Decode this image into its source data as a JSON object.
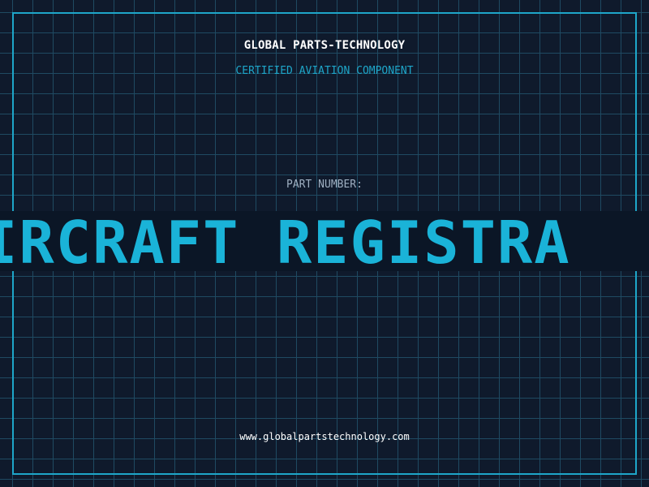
{
  "header": {
    "company_name": "GLOBAL PARTS-TECHNOLOGY",
    "subtitle": "CERTIFIED AVIATION COMPONENT"
  },
  "part": {
    "label": "PART NUMBER:",
    "value_visible": "Y AIRCRAFT REGISTRA"
  },
  "footer": {
    "url": "www.globalpartstechnology.com"
  },
  "colors": {
    "background": "#0f1a2c",
    "grid": "#1f4a62",
    "accent": "#1ea6c9",
    "text": "#ffffff",
    "muted_text": "#9fb0c2"
  }
}
